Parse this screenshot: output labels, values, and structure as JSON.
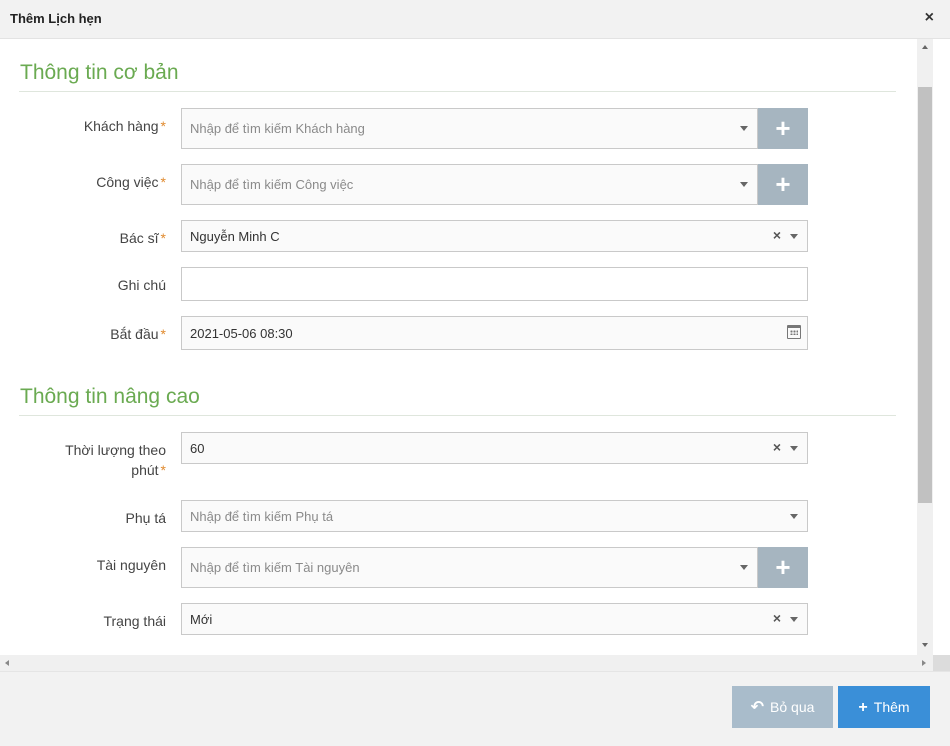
{
  "dialog": {
    "title": "Thêm Lịch hẹn",
    "close_glyph": "×"
  },
  "sections": {
    "basic": "Thông tin cơ bản",
    "advanced": "Thông tin nâng cao"
  },
  "fields": {
    "customer": {
      "label": "Khách hàng",
      "placeholder": "Nhập để tìm kiếm Khách hàng",
      "required": true
    },
    "job": {
      "label": "Công việc",
      "placeholder": "Nhập để tìm kiếm Công việc",
      "required": true
    },
    "doctor": {
      "label": "Bác sĩ",
      "value": "Nguyễn Minh C",
      "required": true
    },
    "note": {
      "label": "Ghi chú",
      "value": ""
    },
    "start": {
      "label": "Bắt đầu",
      "value": "2021-05-06 08:30",
      "required": true
    },
    "duration": {
      "label_line1": "Thời lượng theo",
      "label_line2": "phút",
      "value": "60",
      "required": true
    },
    "assistant": {
      "label": "Phụ tá",
      "placeholder": "Nhập để tìm kiếm Phụ tá"
    },
    "resource": {
      "label": "Tài nguyên",
      "placeholder": "Nhập để tìm kiếm Tài nguyên"
    },
    "status": {
      "label": "Trạng thái",
      "value": "Mới"
    }
  },
  "glyphs": {
    "required": "*",
    "plus": "+",
    "clear": "×"
  },
  "icons": {
    "add": "plus-icon",
    "calendar": "calendar-icon",
    "undo": "undo-icon",
    "dropdown": "chevron-down-icon"
  },
  "footer": {
    "cancel_label": "Bỏ qua",
    "add_label": "Thêm",
    "cancel_icon": "↶",
    "add_icon": "+"
  },
  "colors": {
    "section_title": "#6aaa51",
    "required": "#e08a2e",
    "primary": "#3a8fd8",
    "secondary": "#a9bccb",
    "add_button": "#a6b5c0"
  }
}
